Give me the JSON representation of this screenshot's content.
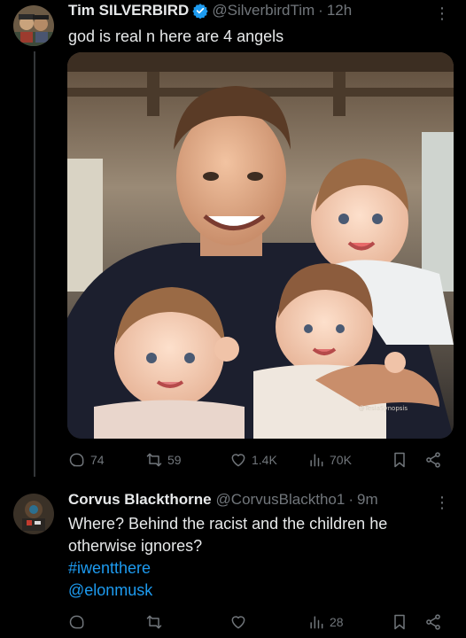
{
  "tweets": [
    {
      "author_name": "Tim SILVERBIRD",
      "handle": "@SilverbirdTim",
      "separator": "·",
      "time": "12h",
      "text": "god is real n here are 4 angels",
      "media_watermark": "@TeslaSynopsis",
      "stats": {
        "replies": "74",
        "retweets": "59",
        "likes": "1.4K",
        "views": "70K"
      }
    },
    {
      "author_name": "Corvus Blackthorne",
      "handle": "@CorvusBlacktho1",
      "separator": "·",
      "time": "9m",
      "text": "Where? Behind the racist and the children he otherwise ignores?",
      "hashtag": "#iwentthere",
      "mention": "@elonmusk",
      "stats": {
        "replies": "",
        "retweets": "",
        "likes": "",
        "views": "28"
      }
    }
  ],
  "more_glyph": "⋮",
  "colors": {
    "background": "#000000",
    "text": "#e7e9ea",
    "muted": "#71767b",
    "link": "#1d9bf0",
    "verified": "#1d9bf0"
  },
  "icons": [
    "reply-icon",
    "retweet-icon",
    "like-icon",
    "views-icon",
    "bookmark-icon",
    "share-icon",
    "verified-badge-icon",
    "more-icon"
  ]
}
